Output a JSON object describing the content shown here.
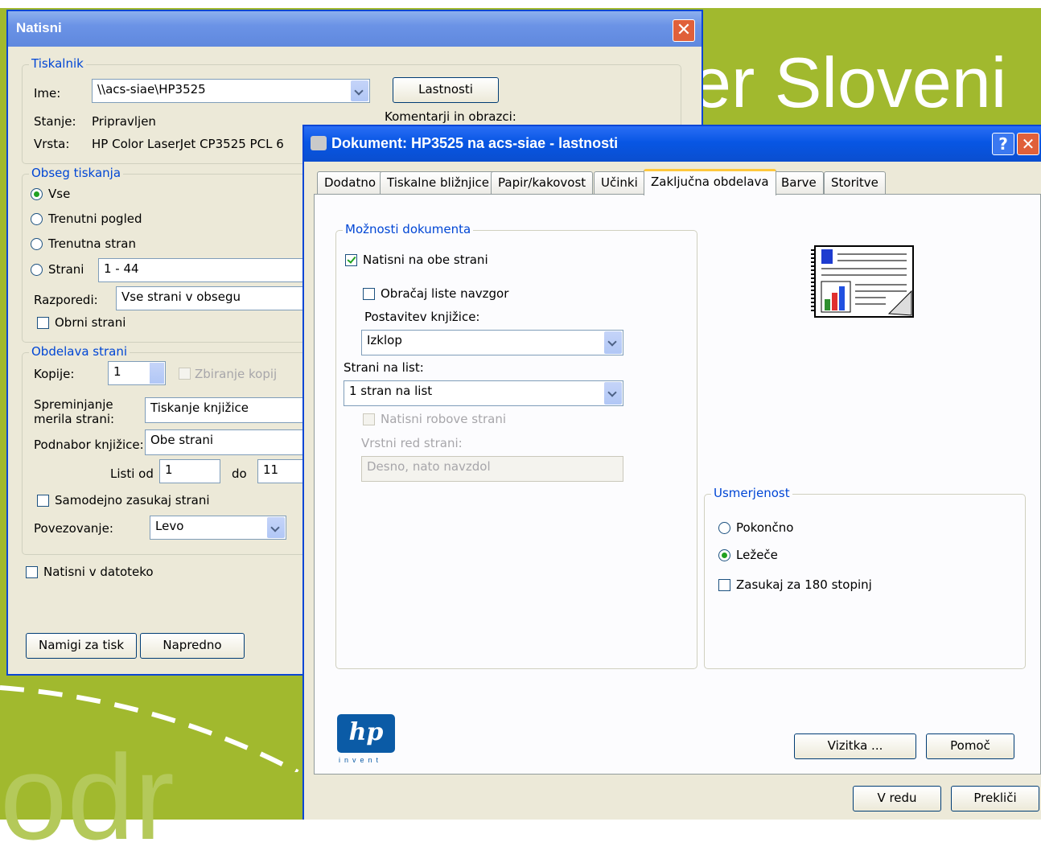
{
  "background": {
    "text": "er Sloveni",
    "letters": "odr",
    "accent": "#a1b92e"
  },
  "main_dialog": {
    "title": "Natisni",
    "close_glyph": "✕",
    "printer": {
      "legend": "Tiskalnik",
      "name_label": "Ime:",
      "name_value": "\\\\acs-siae\\HP3525",
      "properties_button": "Lastnosti",
      "status_label": "Stanje:",
      "status_value": "Pripravljen",
      "type_label": "Vrsta:",
      "type_value": "HP Color LaserJet CP3525 PCL 6",
      "comments_label": "Komentarji in obrazci:"
    },
    "range": {
      "legend": "Obseg tiskanja",
      "all": "Vse",
      "current_view": "Trenutni pogled",
      "current_page": "Trenutna stran",
      "pages": "Strani",
      "pages_value": "1 - 44",
      "arrange_label": "Razporedi:",
      "arrange_value": "Vse strani v obsegu",
      "reverse": "Obrni strani"
    },
    "handling": {
      "legend": "Obdelava strani",
      "copies_label": "Kopije:",
      "copies_value": "1",
      "collate": "Zbiranje kopij",
      "scaling_label_1": "Spreminjanje",
      "scaling_label_2": "merila strani:",
      "scaling_value": "Tiskanje knjižice",
      "subset_label": "Podnabor knjižice:",
      "subset_value": "Obe strani",
      "sheets_from_label": "Listi od",
      "sheets_from_value": "1",
      "sheets_to_label": "do",
      "sheets_to_value": "11",
      "auto_rotate": "Samodejno zasukaj strani",
      "binding_label": "Povezovanje:",
      "binding_value": "Levo"
    },
    "print_to_file": "Natisni v datoteko",
    "tips_button": "Namigi za tisk",
    "advanced_button": "Napredno"
  },
  "props_dialog": {
    "title": "Dokument: HP3525 na acs-siae - lastnosti",
    "help_glyph": "?",
    "close_glyph": "✕",
    "tabs": [
      "Dodatno",
      "Tiskalne bližnjice",
      "Papir/kakovost",
      "Učinki",
      "Zaključna obdelava",
      "Barve",
      "Storitve"
    ],
    "doc_options": {
      "legend": "Možnosti dokumenta",
      "duplex": "Natisni na obe strani",
      "flip_up": "Obračaj liste navzgor",
      "booklet_label": "Postavitev knjižice:",
      "booklet_value": "Izklop",
      "pps_label": "Strani na list:",
      "pps_value": "1 stran na list",
      "borders": "Natisni robove strani",
      "order_label": "Vrstni red strani:",
      "order_value": "Desno, nato navzdol"
    },
    "orientation": {
      "legend": "Usmerjenost",
      "portrait": "Pokončno",
      "landscape": "Ležeče",
      "rotate": "Zasukaj za 180 stopinj"
    },
    "hp_logo": "hp",
    "hp_invent": "invent",
    "about_button": "Vizitka ...",
    "help_button": "Pomoč",
    "ok_button": "V redu",
    "cancel_button": "Prekliči"
  }
}
